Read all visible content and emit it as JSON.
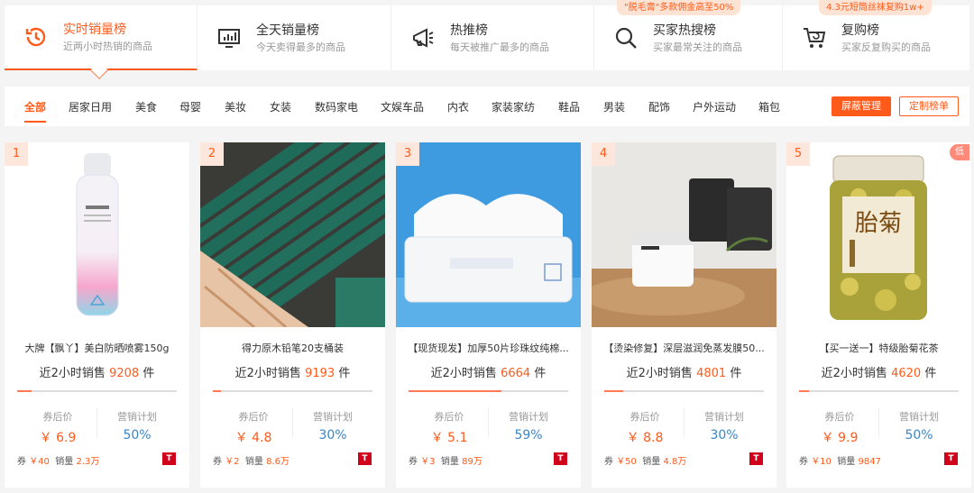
{
  "tabs": [
    {
      "title": "实时销量榜",
      "sub": "近两小时热销的商品",
      "icon": "clock-icon",
      "active": true
    },
    {
      "title": "全天销量榜",
      "sub": "今天卖得最多的商品",
      "icon": "monitor-chart-icon"
    },
    {
      "title": "热推榜",
      "sub": "每天被推广最多的商品",
      "icon": "megaphone-icon"
    },
    {
      "title": "买家热搜榜",
      "sub": "买家最常关注的商品",
      "icon": "search-icon",
      "promo": "\"脱毛膏\"多款佣金高至50%"
    },
    {
      "title": "复购榜",
      "sub": "买家反复购买的商品",
      "icon": "cart-icon",
      "promo": "4.3元短筒丝袜复购1w+"
    }
  ],
  "categories": [
    "全部",
    "居家日用",
    "美食",
    "母婴",
    "美妆",
    "女装",
    "数码家电",
    "文娱车品",
    "内衣",
    "家装家纺",
    "鞋品",
    "男装",
    "配饰",
    "户外运动",
    "箱包"
  ],
  "actions": {
    "block": "屏蔽管理",
    "custom": "定制榜单"
  },
  "labels": {
    "sales_prefix": "近2小时销售",
    "sales_unit": "件",
    "after_coupon": "券后价",
    "plan": "营销计划",
    "coupon": "券",
    "volume": "销量",
    "tmall": "T",
    "low": "低"
  },
  "products": [
    {
      "rank": "1",
      "title": "大牌【飘丫】美白防晒喷雾150g",
      "sales": "9208",
      "progress": 0.09,
      "price": "￥ 6.9",
      "plan": "50%",
      "coupon": "￥40",
      "volume": "2.3万"
    },
    {
      "rank": "2",
      "title": "得力原木铅笔20支桶装",
      "sales": "9193",
      "progress": 0.05,
      "price": "￥ 4.8",
      "plan": "30%",
      "coupon": "￥2",
      "volume": "8.6万"
    },
    {
      "rank": "3",
      "title": "【现货现发】加厚50片珍珠纹纯棉...",
      "sales": "6664",
      "progress": 0.58,
      "price": "￥ 5.1",
      "plan": "59%",
      "coupon": "￥3",
      "volume": "89万"
    },
    {
      "rank": "4",
      "title": "【烫染修复】深层滋润免蒸发膜50...",
      "sales": "4801",
      "progress": 0.12,
      "price": "￥ 8.8",
      "plan": "30%",
      "coupon": "￥50",
      "volume": "4.8万"
    },
    {
      "rank": "5",
      "title": "【买一送一】特级胎菊花茶",
      "sales": "4620",
      "progress": 0.06,
      "price": "￥ 9.9",
      "plan": "50%",
      "coupon": "￥10",
      "volume": "9847"
    }
  ],
  "jar_label": "胎菊"
}
